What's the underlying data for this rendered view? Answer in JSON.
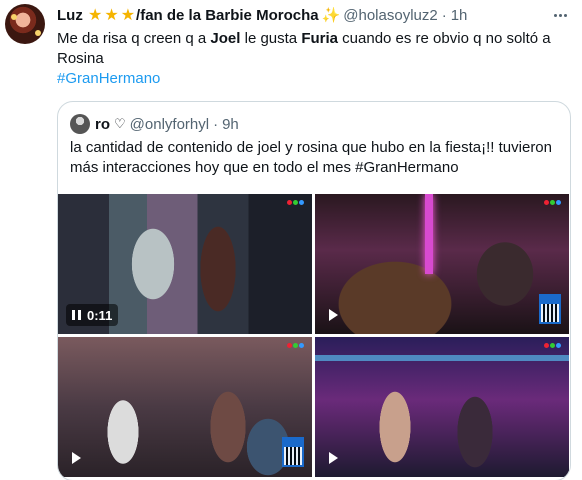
{
  "tweet": {
    "author": {
      "name_prefix": "Luz",
      "stars": [
        "★",
        "★",
        "★"
      ],
      "name_suffix": "/fan de la Barbie Morocha",
      "sparkles": "✨",
      "handle": "@holasoyluz2",
      "separator": "·",
      "time": "1h"
    },
    "text": {
      "part1": "Me da risa q creen q a ",
      "bold1": "Joel",
      "part2": " le gusta ",
      "bold2": "Furia",
      "part3": " cuando es re obvio q no soltó a Rosina"
    },
    "hashtag": "#GranHermano",
    "more_icon": "more-horizontal-icon"
  },
  "quoted": {
    "author": {
      "name": "ro",
      "heart": "♡",
      "handle": "@onlyforhyl",
      "separator": "·",
      "time": "9h"
    },
    "text": "la cantidad de contenido de joel y rosina que hubo en la fiesta¡!! tuvieron más interacciones hoy que en todo el mes #GranHermano",
    "media": [
      {
        "kind": "video",
        "state": "playing",
        "timestamp": "0:11",
        "icon": "pause-icon"
      },
      {
        "kind": "video",
        "state": "paused",
        "icon": "play-icon"
      },
      {
        "kind": "video",
        "state": "paused",
        "icon": "play-icon"
      },
      {
        "kind": "video",
        "state": "paused",
        "icon": "play-icon"
      }
    ]
  },
  "colors": {
    "text": "#0f1419",
    "secondary": "#536471",
    "link": "#1d9bf0",
    "border": "#cfd9de",
    "star": "#f5b400"
  }
}
